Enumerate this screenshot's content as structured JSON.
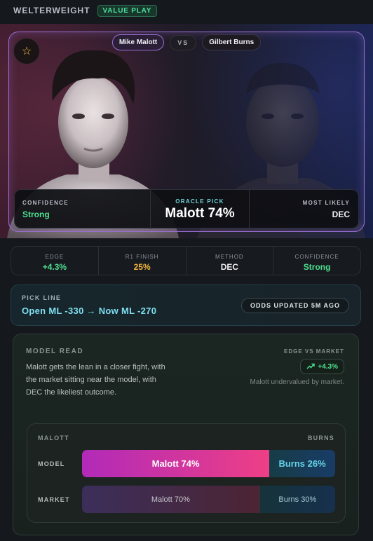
{
  "header": {
    "weight_class": "WELTERWEIGHT",
    "badge": "VALUE PLAY"
  },
  "matchup": {
    "fighter_a": "Mike Malott",
    "vs": "VS",
    "fighter_b": "Gilbert Burns",
    "favorite_icon": "star-icon"
  },
  "pick_panel": {
    "confidence_label": "CONFIDENCE",
    "confidence_value": "Strong",
    "oracle_label": "ORACLE PICK",
    "oracle_value": "Malott 74%",
    "likely_label": "MOST LIKELY",
    "likely_value": "DEC"
  },
  "stats": [
    {
      "label": "EDGE",
      "value": "+4.3%",
      "color": "#4ee08f"
    },
    {
      "label": "R1 FINISH",
      "value": "25%",
      "color": "#f2b63c"
    },
    {
      "label": "METHOD",
      "value": "DEC",
      "color": "#f1f1f4"
    },
    {
      "label": "CONFIDENCE",
      "value": "Strong",
      "color": "#4ee08f"
    }
  ],
  "pick_line": {
    "label": "PICK LINE",
    "text": "Open ML -330 → Now ML -270",
    "odds_badge": "ODDS UPDATED 5M AGO"
  },
  "model_read": {
    "label": "MODEL READ",
    "text": "Malott gets the lean in a closer fight, with the market sitting near the model, with DEC the likeliest outcome.",
    "edge_label": "EDGE VS MARKET",
    "edge_value": "+4.3%",
    "edge_icon": "trend-up-icon",
    "edge_note": "Malott undervalued by market."
  },
  "comparison": {
    "left_name": "MALOTT",
    "right_name": "BURNS",
    "rows": [
      {
        "label": "MODEL",
        "left_text": "Malott 74%",
        "right_text": "Burns 26%",
        "left_share": 0.74
      },
      {
        "label": "MARKET",
        "left_text": "Malott 70%",
        "right_text": "Burns 30%",
        "left_share": 0.7
      }
    ]
  },
  "colors": {
    "accent": "#9b6fd6",
    "positive": "#4ee08f",
    "warning": "#f2b63c",
    "cyan": "#7fdff0"
  }
}
